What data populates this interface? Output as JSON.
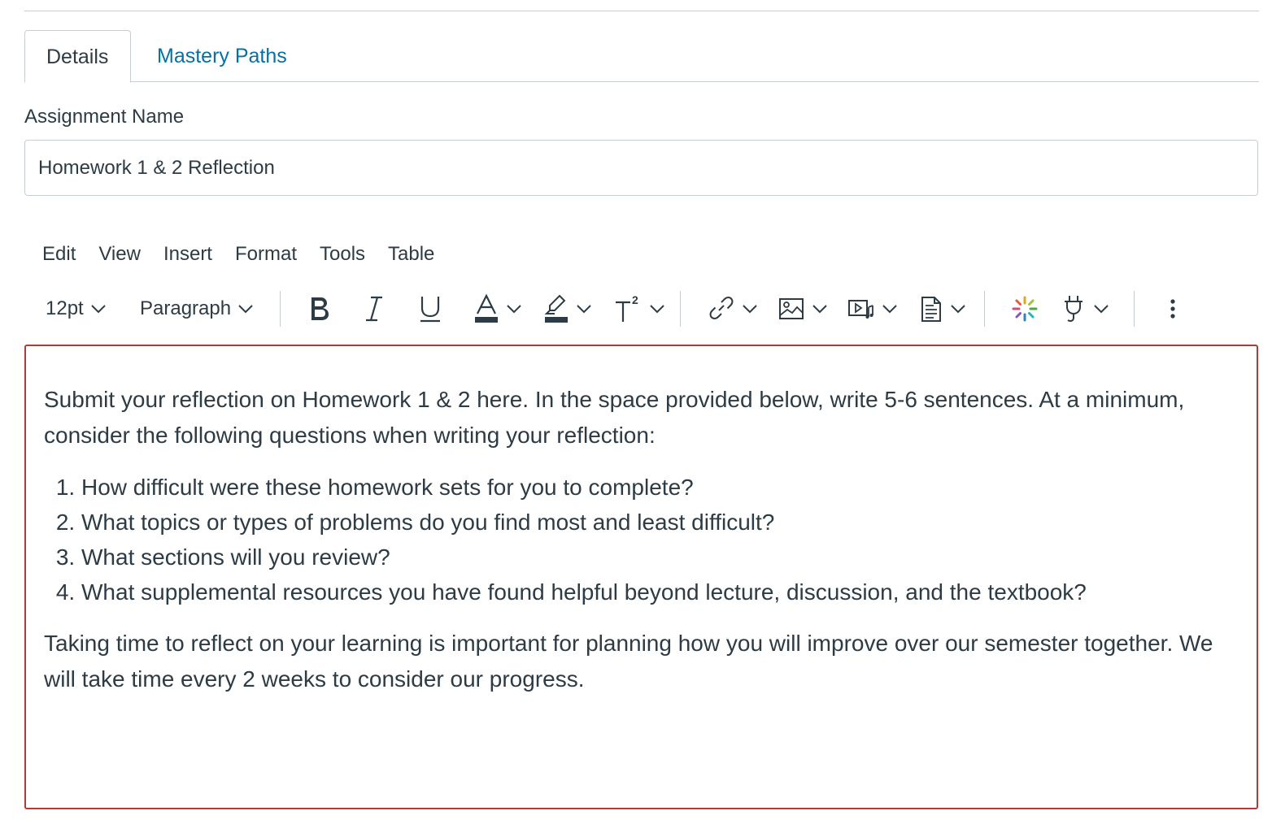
{
  "tabs": [
    {
      "label": "Details",
      "active": true
    },
    {
      "label": "Mastery Paths",
      "active": false
    }
  ],
  "assignment": {
    "label": "Assignment Name",
    "value": "Homework 1 & 2 Reflection"
  },
  "menubar": [
    "Edit",
    "View",
    "Insert",
    "Format",
    "Tools",
    "Table"
  ],
  "toolbar": {
    "font_size": "12pt",
    "block_format": "Paragraph",
    "icons": [
      "bold-icon",
      "italic-icon",
      "underline-icon",
      "text-color-icon",
      "highlight-icon",
      "superscript-icon",
      "link-icon",
      "image-icon",
      "media-icon",
      "document-icon",
      "apps-icon",
      "plugin-icon",
      "more-options-icon"
    ]
  },
  "editor": {
    "intro": "Submit your reflection on Homework 1 & 2 here. In the space provided below, write 5-6 sentences. At a minimum, consider the following questions when writing your reflection:",
    "questions": [
      "How difficult were these homework sets for you to complete?",
      "What topics or types of problems do you find most and least difficult?",
      "What sections will you review?",
      "What supplemental resources you have found helpful beyond lecture, discussion, and the textbook?"
    ],
    "closing": "Taking time to reflect on your learning is important for planning how you will improve over our semester together. We will take time every 2 weeks to consider our progress."
  },
  "colors": {
    "text": "#2d3b45",
    "link": "#0770a3",
    "border": "#c7cdd1",
    "editor_border": "#b43a3a"
  }
}
